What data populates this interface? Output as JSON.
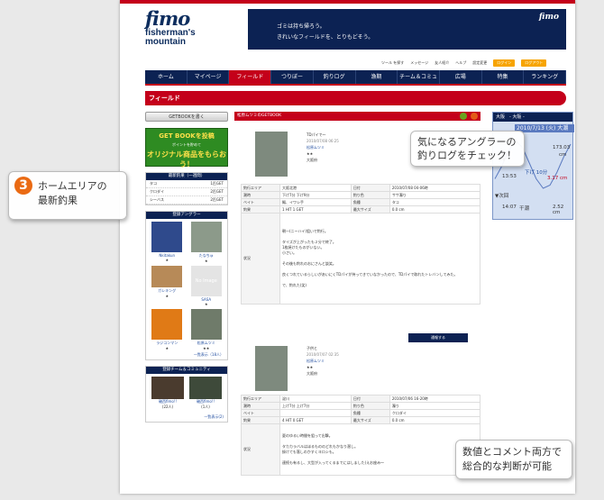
{
  "logo": {
    "script": "fimo",
    "sub1": "fisherman's",
    "sub2": "mountain"
  },
  "banner": {
    "line1": "ゴミは持ち帰ろう。",
    "line2": "きれいなフィールドを、とりもどそう。",
    "logo": "fimo"
  },
  "util": {
    "items": [
      "ツール を探す",
      "メッセージ",
      "友人紹介",
      "ヘルプ",
      "設定変更"
    ],
    "pill1": "ログイン",
    "pill2": "ログアウト"
  },
  "nav": {
    "items": [
      "ホーム",
      "マイページ",
      "フィールド",
      "つりぼー",
      "釣りログ",
      "漁期",
      "チーム＆コミュ",
      "広場",
      "特集",
      "ランキング"
    ]
  },
  "section": {
    "title": "フィールド"
  },
  "sidebar": {
    "getbook_button": "GETBOOKを書く",
    "promo": {
      "l1": "GET BOOKを投稿",
      "l2": "ポイントを貯めて",
      "l3": "オリジナル商品をもらおう！"
    },
    "catches": {
      "title": "最新釣果（一週間）",
      "rows": [
        {
          "fish": "タコ",
          "count": "1匹GET"
        },
        {
          "fish": "クロダイ",
          "count": "2匹GET"
        },
        {
          "fish": "シーバス",
          "count": "2匹GET"
        }
      ]
    },
    "anglers": {
      "title": "登録アングラー",
      "items": [
        {
          "name": "Nkitakun",
          "stars": "★"
        },
        {
          "name": "たなちゅ",
          "stars": "★"
        },
        {
          "name": "ガレキング",
          "stars": "★"
        },
        {
          "name": "SASA",
          "stars": "★",
          "noimage": "No Image"
        },
        {
          "name": "ラジコンマン",
          "stars": "★"
        },
        {
          "name": "松原ムツミ",
          "stars": "★★"
        }
      ],
      "more": "一覧表示（18人）"
    },
    "teams": {
      "title": "登録チーム＆コミュニティ",
      "items": [
        {
          "name": "磯西fimo!!",
          "count": "(22人)"
        },
        {
          "name": "磯西fimo!!",
          "count": "(1人)"
        }
      ],
      "more": "一覧表示(2)"
    }
  },
  "main": {
    "header": "松原ムツミのGETBOOK",
    "entry1": {
      "title": "TDパイで～",
      "date": "2010/07/08 06:25",
      "user": "松原ムツミ",
      "stars": "★★",
      "pref": "大阪府",
      "rows": [
        [
          "釣行エリア",
          "大阪北港",
          "日付",
          "2010/07/08 04-06時"
        ],
        [
          "潮時",
          "下げ7分 下げ9分",
          "釣り色",
          "ササ濁り"
        ],
        [
          "ベイト",
          "鰯、イワシ手",
          "魚種",
          "タコ"
        ],
        [
          "釣果",
          "1 HIT 1 GET",
          "最大サイズ",
          "0.0 cm"
        ]
      ],
      "comment_label": "状況",
      "comment": [
        "朝一(ニーハイ)狙いで釣行。",
        "タイズが上がったも２分で終了。",
        "1枚焼けたものがいない。",
        "小さい。",
        "その後も釣れのおにさんと談笑。",
        "良くつれているらしいがあいにくTDパイが持ってきていなかったので、TDパイで取れたトレバンしてみた。",
        "で、釣れた(笑)"
      ],
      "register_button": "通報する"
    },
    "entry2": {
      "title": "子供と",
      "date": "2010/07/07 02:35",
      "user": "松原ムツミ",
      "stars": "★★",
      "pref": "大阪府",
      "rows": [
        [
          "釣行エリア",
          "淀川",
          "日付",
          "2010/07/06 16-20時"
        ],
        [
          "潮時",
          "上げ7分 上げ7分",
          "釣り色",
          "濁り"
        ],
        [
          "ベイト",
          "",
          "魚種",
          "クロダイ"
        ],
        [
          "釣果",
          "4 HIT 0 GET",
          "最大サイズ",
          "0.0 cm"
        ]
      ],
      "comment_label": "状況",
      "comment": [
        "夏のゆるい時間を狙って出撃。",
        "タカカラバルはほるもののどれもかなり潜し。",
        "掛けても落しのかすくヨロシも。",
        "連続も有るし、大型が入ってくるまでにはしました(えお座み～"
      ]
    }
  },
  "tide": {
    "header": "大阪　- 大阪 -",
    "date": "2010/7/13 (火) 大潮",
    "times": [
      "13:53",
      "14:07"
    ],
    "labels": {
      "up": "173.03",
      "down1": "下げ 10分",
      "down2": "3.17 cm",
      "next": "▼次回",
      "next_val": "2.52 cm",
      "next_type": "干潮",
      "cm": "cm",
      "arrow": "▼"
    },
    "curve": [
      0.35,
      0.55,
      0.8,
      0.95,
      0.85,
      0.6,
      0.35,
      0.2,
      0.25,
      0.45,
      0.7,
      0.9
    ]
  },
  "callouts": {
    "left": {
      "num": "3",
      "l1": "ホームエリアの",
      "l2": "最新釣果"
    },
    "right_top": {
      "l1": "気になるアングラーの",
      "l2": "釣りログをチェック！"
    },
    "right_bottom": {
      "l1": "数値とコメント両方で",
      "l2": "総合的な判断が可能"
    }
  },
  "colors": {
    "navy": "#0c2253",
    "red": "#c4001a",
    "orange": "#ea6a13"
  }
}
